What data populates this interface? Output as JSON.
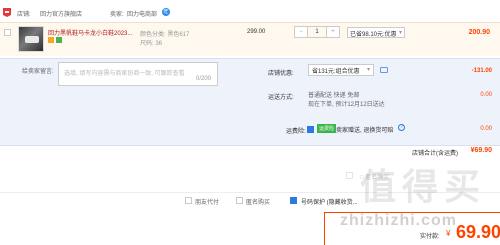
{
  "shop": {
    "label": "店铺:",
    "name": "回力官方旗舰店",
    "seller_label": "卖家:",
    "seller_name": "回力电商部",
    "ww_icon": "wangwang-chat-icon"
  },
  "item": {
    "title": "回力黑帆鞋马卡龙小白鞋2023...",
    "sku_color": "颜色分类: 黑色617",
    "sku_size": "尺码: 36",
    "unit_price": "299.00",
    "quantity": "1",
    "qty_minus": "−",
    "qty_plus": "+",
    "promo": "已省98.10元:优惠",
    "total": "200.90"
  },
  "message": {
    "label": "给卖家留言:",
    "placeholder": "选填, 填写内容需与商家协商一致, 可跟踪查看",
    "count": "0/200"
  },
  "coupon": {
    "label": "店铺优惠:",
    "value": "省131元:组合优惠",
    "amount": "-131.00"
  },
  "shipping": {
    "label": "运送方式:",
    "method": "普通配送 快递 免邮",
    "time": "现在下单, 预计12月12日送达",
    "fee": "0.00"
  },
  "service": {
    "label": "运费险:",
    "tag": "运费险",
    "text": "卖家赠送, 退换货可赔",
    "help": "?",
    "fee": "0.00"
  },
  "shop_total": {
    "label": "店铺合计(含运费)",
    "value": "¥69.90"
  },
  "faded": {
    "text": "□ 匿名购买"
  },
  "options": {
    "opt1": "朋友代付",
    "opt2": "匿名购买",
    "opt3": "号码保护 (隐藏收货..."
  },
  "payment": {
    "label": "实付款:",
    "currency": "¥",
    "amount": "69.90"
  },
  "watermark": {
    "chars": [
      "值",
      "得",
      "买"
    ],
    "url": "zhizhizhi.com"
  },
  "colors": {
    "accent": "#ff4400",
    "link": "#2a7ae2",
    "panel": "#eef2fb"
  }
}
